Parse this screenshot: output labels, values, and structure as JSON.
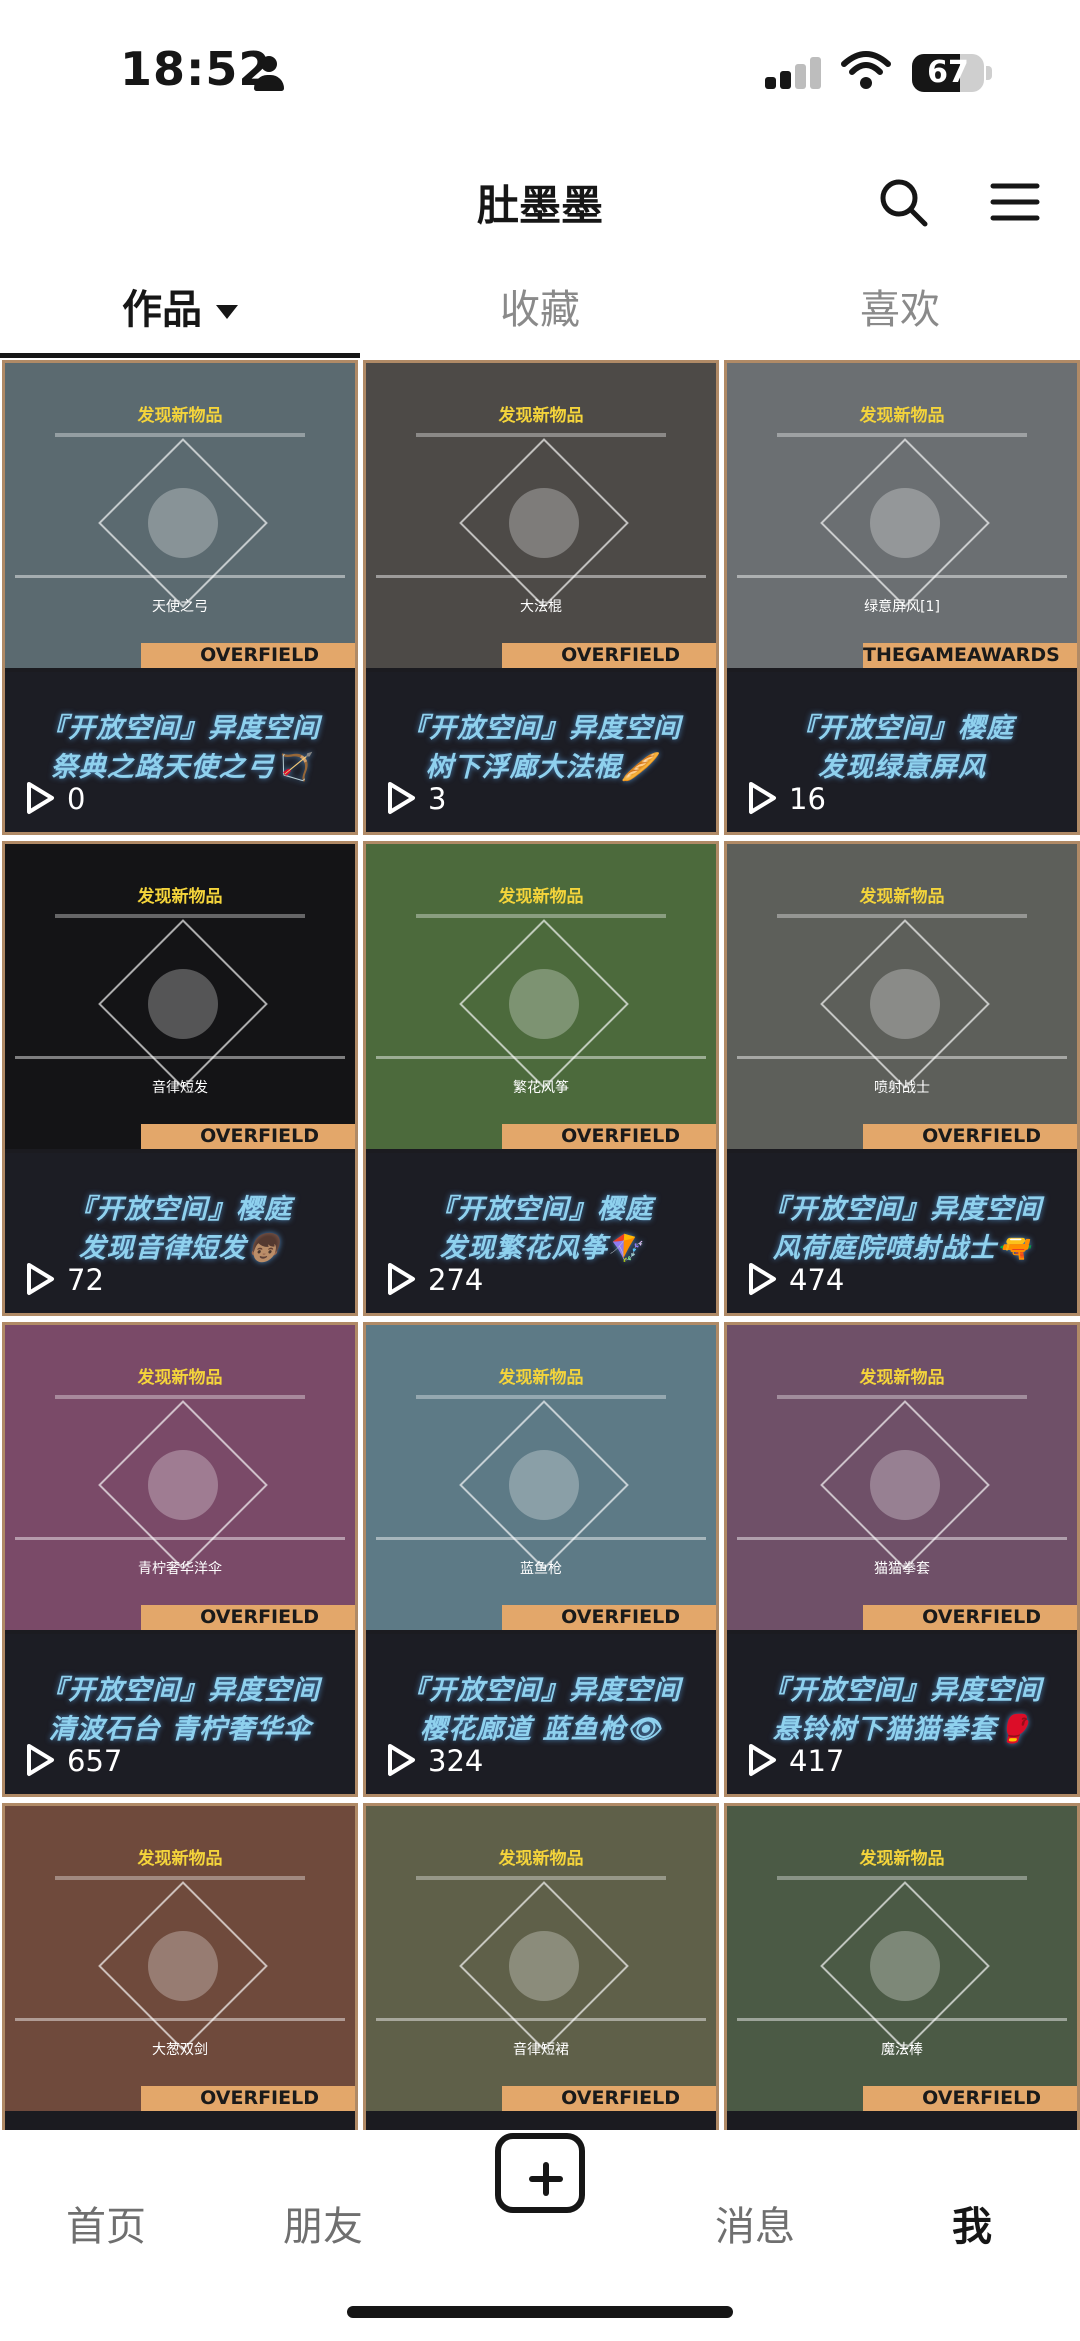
{
  "status_bar": {
    "time": "18:52",
    "battery": "67",
    "battery_level": 0.67
  },
  "header": {
    "title": "肚墨墨"
  },
  "tabs": [
    {
      "label": "作品",
      "active": true
    },
    {
      "label": "收藏",
      "active": false
    },
    {
      "label": "喜欢",
      "active": false
    }
  ],
  "posts": [
    {
      "found": "发现新物品",
      "item": "天使之弓",
      "brand": "OVERFIELD",
      "caption1": "『开放空间』异度空间",
      "caption2": "祭典之路天使之弓🏹",
      "views": "0",
      "bg": "#5b6a70"
    },
    {
      "found": "发现新物品",
      "item": "大法棍",
      "brand": "OVERFIELD",
      "caption1": "『开放空间』异度空间",
      "caption2": "树下浮廊大法棍🥖",
      "views": "3",
      "bg": "#4d4a47"
    },
    {
      "found": "发现新物品",
      "item": "绿意屏风[1]",
      "brand": "THEGAMEAWARDS",
      "caption1": "『开放空间』樱庭",
      "caption2": "发现绿意屏风",
      "views": "16",
      "bg": "#6b6f72"
    },
    {
      "found": "发现新物品",
      "item": "音律短发",
      "brand": "OVERFIELD",
      "caption1": "『开放空间』樱庭",
      "caption2": "发现音律短发👦🏽",
      "views": "72",
      "bg": "#141416"
    },
    {
      "found": "发现新物品",
      "item": "繁花风筝",
      "brand": "OVERFIELD",
      "caption1": "『开放空间』樱庭",
      "caption2": "发现繁花风筝🪁",
      "views": "274",
      "bg": "#4c6a3c"
    },
    {
      "found": "发现新物品",
      "item": "喷射战士",
      "brand": "OVERFIELD",
      "caption1": "『开放空间』异度空间",
      "caption2": "风荷庭院喷射战士🔫",
      "views": "474",
      "bg": "#5d5f5a"
    },
    {
      "found": "发现新物品",
      "item": "青柠奢华洋伞",
      "brand": "OVERFIELD",
      "caption1": "『开放空间』异度空间",
      "caption2": "清波石台 青柠奢华伞",
      "views": "657",
      "bg": "#7a4a68"
    },
    {
      "found": "发现新物品",
      "item": "蓝鱼枪",
      "brand": "OVERFIELD",
      "caption1": "『开放空间』异度空间",
      "caption2": "樱花廊道 蓝鱼枪👁",
      "views": "324",
      "bg": "#5d7a86"
    },
    {
      "found": "发现新物品",
      "item": "猫猫拳套",
      "brand": "OVERFIELD",
      "caption1": "『开放空间』异度空间",
      "caption2": "悬铃树下猫猫拳套🥊",
      "views": "417",
      "bg": "#6f5068"
    },
    {
      "found": "发现新物品",
      "item": "大葱双剑",
      "brand": "OVERFIELD",
      "bg": "#6f4a3c"
    },
    {
      "found": "发现新物品",
      "item": "音律短裙",
      "brand": "OVERFIELD",
      "bg": "#5f6049"
    },
    {
      "found": "发现新物品",
      "item": "魔法棒",
      "brand": "OVERFIELD",
      "bg": "#4b5a45"
    }
  ],
  "bottom_nav": [
    {
      "label": "首页",
      "active": false
    },
    {
      "label": "朋友",
      "active": false
    },
    {
      "label": "消息",
      "active": false
    },
    {
      "label": "我",
      "active": true
    }
  ]
}
